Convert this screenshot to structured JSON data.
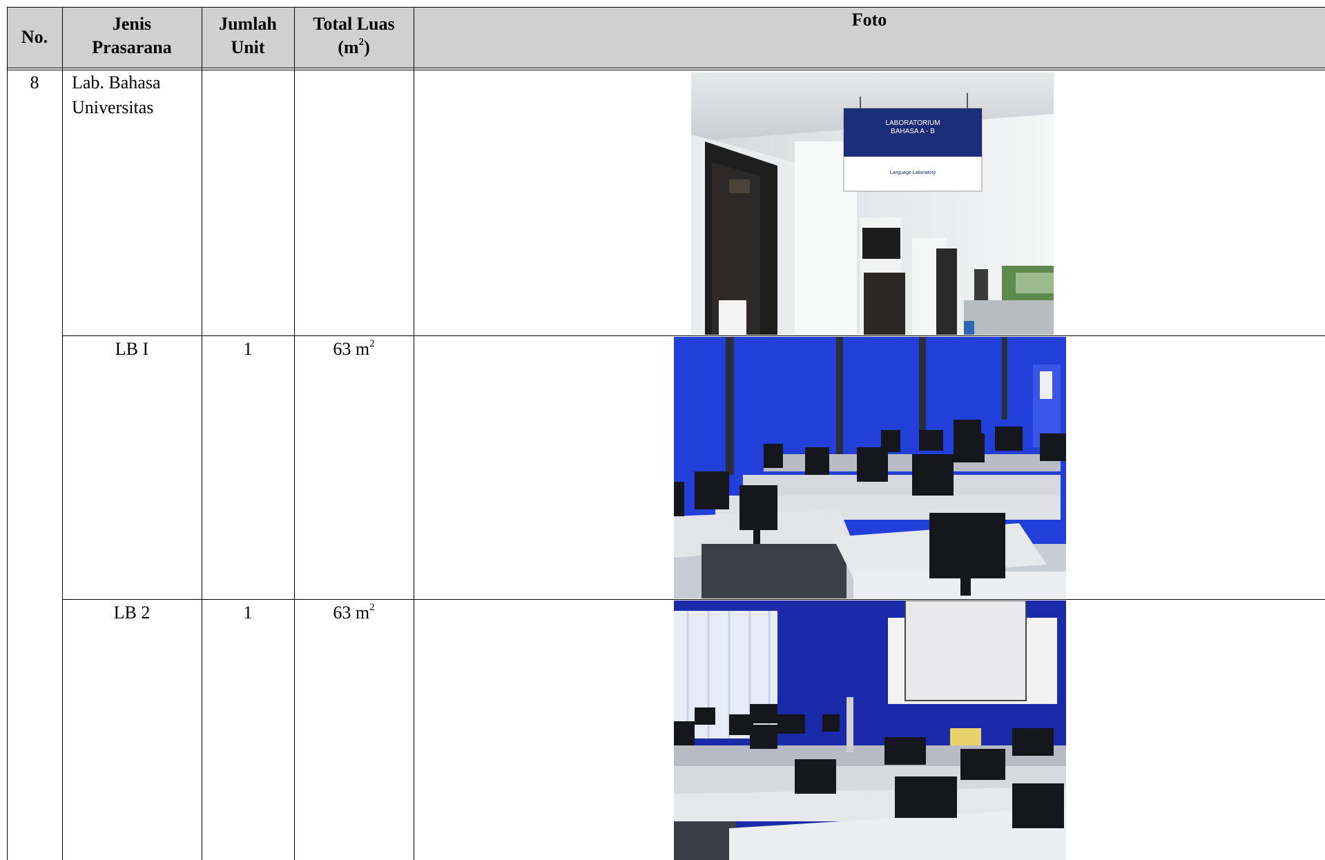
{
  "header": {
    "no": "No.",
    "jenis_line1": "Jenis",
    "jenis_line2": "Prasarana",
    "jumlah_line1": "Jumlah",
    "jumlah_line2": "Unit",
    "luas_line1": "Total Luas",
    "luas_line2_pre": "(m",
    "luas_line2_sup": "2",
    "luas_line2_post": ")",
    "foto": "Foto"
  },
  "rows": [
    {
      "no": "8",
      "jenis_line1": "Lab. Bahasa",
      "jenis_line2": "Universitas",
      "jumlah": "",
      "luas_value": "",
      "luas_sup": "",
      "photo_icon": "building-corridor-photo",
      "sign_line1": "LABORATORIUM",
      "sign_line2": "BAHASA  A - B",
      "sign_line3": "Language Laboratory"
    },
    {
      "no": "",
      "jenis": "LB I",
      "jumlah": "1",
      "luas_value": "63 m",
      "luas_sup": "2",
      "photo_icon": "computer-lab-photo"
    },
    {
      "no": "",
      "jenis": "LB 2",
      "jumlah": "1",
      "luas_value": "63 m",
      "luas_sup": "2",
      "photo_icon": "computer-lab-projector-photo"
    }
  ],
  "colors": {
    "header_bg": "#d0d0d0",
    "lab_wall": "#1f3bd6",
    "sign_blue": "#1c2d7a"
  }
}
